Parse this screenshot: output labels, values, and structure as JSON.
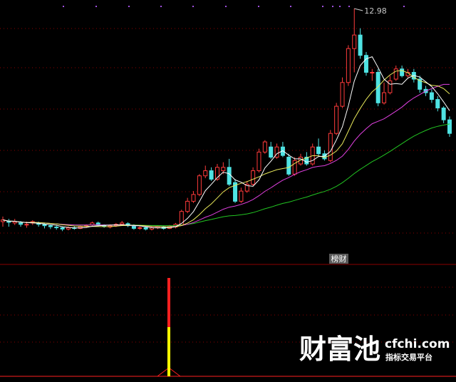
{
  "chart_data": {
    "type": "candlestick",
    "peak_label": "12.98",
    "badge_label": "榜财",
    "colors": {
      "up": "#ff3b3b",
      "down": "#4fe3e3",
      "ma_white": "#ffffff",
      "ma_yellow": "#e8e85a",
      "ma_magenta": "#e040e0",
      "ma_green": "#22c422",
      "grid": "#8b0000",
      "indicator_red": "#ff2020",
      "indicator_yellow": "#ffff00",
      "top_dots": "#a050e0"
    },
    "candles": [
      [
        6.7,
        6.75,
        6.55,
        6.85
      ],
      [
        6.72,
        6.68,
        6.55,
        6.78
      ],
      [
        6.66,
        6.7,
        6.6,
        6.78
      ],
      [
        6.66,
        6.62,
        6.55,
        6.72
      ],
      [
        6.6,
        6.62,
        6.52,
        6.7
      ],
      [
        6.66,
        6.7,
        6.6,
        6.74
      ],
      [
        6.66,
        6.62,
        6.55,
        6.7
      ],
      [
        6.62,
        6.58,
        6.5,
        6.66
      ],
      [
        6.58,
        6.55,
        6.48,
        6.62
      ],
      [
        6.54,
        6.52,
        6.46,
        6.58
      ],
      [
        6.52,
        6.48,
        6.42,
        6.56
      ],
      [
        6.48,
        6.52,
        6.44,
        6.56
      ],
      [
        6.52,
        6.5,
        6.46,
        6.56
      ],
      [
        6.5,
        6.55,
        6.48,
        6.58
      ],
      [
        6.56,
        6.58,
        6.52,
        6.62
      ],
      [
        6.6,
        6.66,
        6.56,
        6.7
      ],
      [
        6.66,
        6.6,
        6.56,
        6.7
      ],
      [
        6.58,
        6.56,
        6.52,
        6.62
      ],
      [
        6.54,
        6.58,
        6.5,
        6.62
      ],
      [
        6.58,
        6.62,
        6.54,
        6.66
      ],
      [
        6.62,
        6.66,
        6.58,
        6.72
      ],
      [
        6.64,
        6.58,
        6.54,
        6.68
      ],
      [
        6.58,
        6.5,
        6.46,
        6.62
      ],
      [
        6.5,
        6.52,
        6.46,
        6.56
      ],
      [
        6.52,
        6.48,
        6.44,
        6.56
      ],
      [
        6.48,
        6.52,
        6.44,
        6.56
      ],
      [
        6.52,
        6.55,
        6.48,
        6.58
      ],
      [
        6.54,
        6.5,
        6.46,
        6.58
      ],
      [
        6.5,
        6.56,
        6.48,
        6.6
      ],
      [
        6.54,
        6.62,
        6.5,
        6.66
      ],
      [
        6.6,
        7.0,
        6.58,
        7.05
      ],
      [
        7.0,
        7.3,
        6.95,
        7.4
      ],
      [
        7.3,
        7.5,
        7.25,
        7.6
      ],
      [
        7.5,
        8.05,
        7.45,
        8.1
      ],
      [
        8.05,
        8.2,
        7.98,
        8.35
      ],
      [
        8.2,
        7.95,
        7.9,
        8.3
      ],
      [
        7.95,
        8.3,
        7.9,
        8.4
      ],
      [
        8.2,
        8.3,
        8.1,
        8.45
      ],
      [
        8.3,
        7.8,
        7.75,
        8.55
      ],
      [
        7.85,
        7.3,
        7.25,
        7.95
      ],
      [
        7.3,
        7.6,
        7.25,
        7.7
      ],
      [
        7.6,
        7.8,
        7.55,
        7.9
      ],
      [
        7.8,
        8.2,
        7.75,
        8.3
      ],
      [
        8.2,
        8.75,
        8.15,
        8.85
      ],
      [
        8.75,
        9.05,
        8.7,
        9.1
      ],
      [
        8.9,
        8.6,
        8.55,
        9.05
      ],
      [
        8.6,
        8.9,
        8.55,
        9.0
      ],
      [
        8.9,
        8.65,
        8.6,
        9.05
      ],
      [
        8.6,
        8.1,
        8.05,
        8.7
      ],
      [
        8.1,
        8.5,
        8.05,
        8.6
      ],
      [
        8.4,
        8.6,
        8.35,
        8.7
      ],
      [
        8.6,
        8.4,
        8.35,
        8.75
      ],
      [
        8.4,
        8.9,
        8.35,
        9.0
      ],
      [
        8.9,
        8.7,
        8.65,
        9.15
      ],
      [
        8.7,
        8.55,
        8.5,
        8.8
      ],
      [
        8.5,
        9.3,
        8.45,
        9.4
      ],
      [
        9.3,
        10.1,
        9.25,
        10.2
      ],
      [
        10.1,
        10.8,
        10.05,
        10.95
      ],
      [
        10.8,
        11.8,
        10.7,
        11.9
      ],
      [
        11.8,
        12.2,
        11.1,
        12.98
      ],
      [
        12.2,
        11.6,
        11.5,
        12.4
      ],
      [
        11.6,
        11.1,
        11.0,
        11.7
      ],
      [
        11.1,
        11.1,
        10.85,
        11.2
      ],
      [
        11.1,
        10.2,
        10.1,
        11.2
      ],
      [
        10.2,
        10.5,
        10.15,
        10.8
      ],
      [
        10.5,
        10.85,
        10.45,
        11.0
      ],
      [
        10.9,
        11.2,
        10.85,
        11.3
      ],
      [
        11.2,
        11.0,
        10.95,
        11.3
      ],
      [
        11.0,
        11.1,
        10.95,
        11.2
      ],
      [
        11.1,
        10.9,
        10.8,
        11.2
      ],
      [
        10.9,
        10.6,
        10.5,
        11.0
      ],
      [
        10.6,
        10.5,
        10.4,
        10.7
      ],
      [
        10.5,
        10.3,
        10.2,
        10.6
      ],
      [
        10.3,
        10.05,
        9.95,
        10.4
      ],
      [
        10.05,
        9.7,
        9.6,
        10.1
      ],
      [
        9.7,
        9.3,
        9.2,
        9.8
      ]
    ],
    "indicator": {
      "signal_index": 29,
      "signal_value": 100,
      "yellow_portion": 50
    }
  }
}
